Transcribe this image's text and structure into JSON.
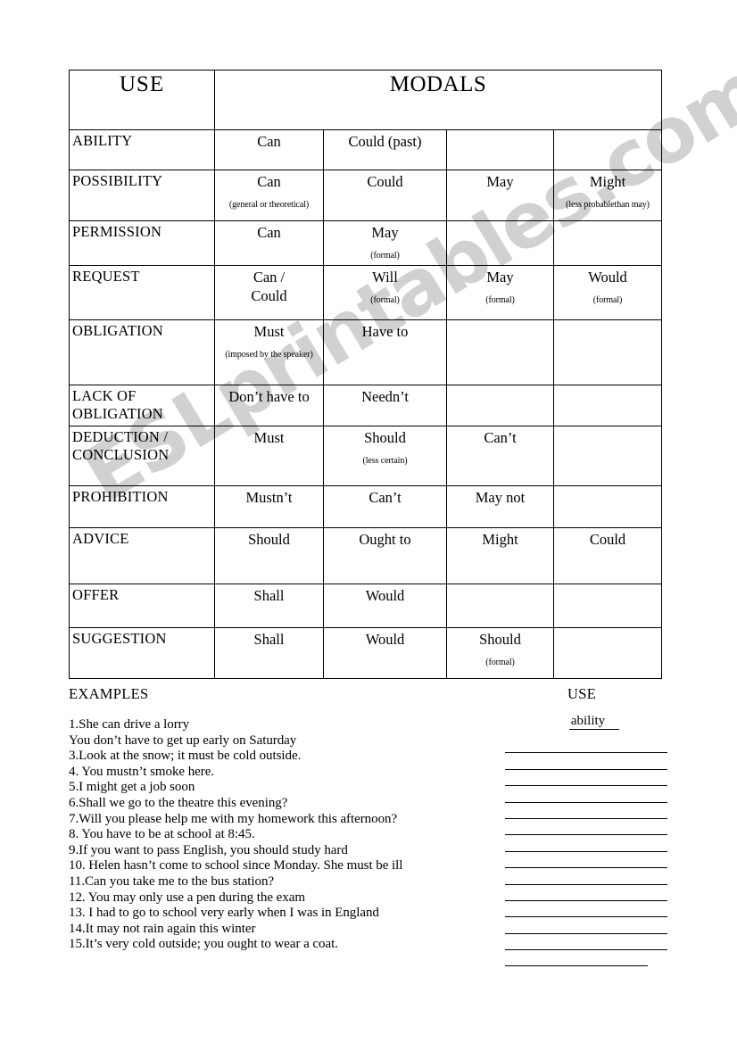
{
  "watermark": {
    "text": "ESLprintables.com"
  },
  "table": {
    "header": {
      "use": "USE",
      "modals": "MODALS"
    },
    "rows": [
      {
        "use": "ABILITY",
        "cells": [
          {
            "word": "Can",
            "note": ""
          },
          {
            "word": "Could (past)",
            "note": ""
          },
          {
            "word": "",
            "note": ""
          },
          {
            "word": "",
            "note": ""
          }
        ]
      },
      {
        "use": "POSSIBILITY",
        "cells": [
          {
            "word": "Can",
            "note": "(general or theoretical)"
          },
          {
            "word": "Could",
            "note": ""
          },
          {
            "word": "May",
            "note": ""
          },
          {
            "word": "Might",
            "note": "(less probablethan may)"
          }
        ]
      },
      {
        "use": "PERMISSION",
        "cells": [
          {
            "word": "Can",
            "note": ""
          },
          {
            "word": "May",
            "note": "(formal)"
          },
          {
            "word": "",
            "note": ""
          },
          {
            "word": "",
            "note": ""
          }
        ]
      },
      {
        "use": "REQUEST",
        "cells": [
          {
            "word": "Can /",
            "word2": "Could",
            "note": ""
          },
          {
            "word": "Will",
            "note": "(formal)"
          },
          {
            "word": "May",
            "note": "(formal)"
          },
          {
            "word": "Would",
            "note": "(formal)"
          }
        ]
      },
      {
        "use": "OBLIGATION",
        "cells": [
          {
            "word": "Must",
            "note": "(imposed by the speaker)"
          },
          {
            "word": "Have to",
            "note": ""
          },
          {
            "word": "",
            "note": ""
          },
          {
            "word": "",
            "note": ""
          }
        ]
      },
      {
        "use": "LACK OF OBLIGATION",
        "cells": [
          {
            "word": "Don’t have to",
            "note": ""
          },
          {
            "word": "Needn’t",
            "note": ""
          },
          {
            "word": "",
            "note": ""
          },
          {
            "word": "",
            "note": ""
          }
        ]
      },
      {
        "use": "DEDUCTION / CONCLUSION",
        "cells": [
          {
            "word": "Must",
            "note": ""
          },
          {
            "word": "Should",
            "note": "(less certain)"
          },
          {
            "word": "Can’t",
            "note": ""
          },
          {
            "word": "",
            "note": ""
          }
        ]
      },
      {
        "use": "PROHIBITION",
        "cells": [
          {
            "word": "Mustn’t",
            "note": ""
          },
          {
            "word": "Can’t",
            "note": ""
          },
          {
            "word": "May not",
            "note": ""
          },
          {
            "word": "",
            "note": ""
          }
        ]
      },
      {
        "use": "ADVICE",
        "cells": [
          {
            "word": "Should",
            "note": ""
          },
          {
            "word": "Ought to",
            "note": ""
          },
          {
            "word": "Might",
            "note": ""
          },
          {
            "word": "Could",
            "note": ""
          }
        ]
      },
      {
        "use": "OFFER",
        "cells": [
          {
            "word": "Shall",
            "note": ""
          },
          {
            "word": "Would",
            "note": ""
          },
          {
            "word": "",
            "note": ""
          },
          {
            "word": "",
            "note": ""
          }
        ]
      },
      {
        "use": "SUGGESTION",
        "cells": [
          {
            "word": "Shall",
            "note": ""
          },
          {
            "word": "Would",
            "note": ""
          },
          {
            "word": "Should",
            "note": "(formal)"
          },
          {
            "word": "",
            "note": ""
          }
        ]
      }
    ]
  },
  "exercise": {
    "examples_heading": "EXAMPLES",
    "use_heading": "USE",
    "examples": [
      "1.She can drive a lorry",
      "You don’t have to get up early on Saturday",
      "3.Look at the snow; it must be cold outside.",
      "4. You mustn’t smoke here.",
      "5.I might get a job soon",
      "6.Shall we go to the theatre this evening?",
      "7.Will you please help me with my homework this afternoon?",
      "8. You have to be at school at 8:45.",
      "9.If you want to pass English, you should study hard",
      "10. Helen hasn’t come to school since Monday. She must be ill",
      "11.Can you take me to the bus station?",
      "12. You may only use a pen during the exam",
      "13. I had to go to school very early when I was in England",
      "14.It may not rain again this winter",
      "15.It’s very cold outside; you ought to wear a coat."
    ],
    "answers": [
      "ability",
      "",
      "",
      "",
      "",
      "",
      "",
      "",
      "",
      "",
      "",
      "",
      "",
      "",
      ""
    ]
  }
}
